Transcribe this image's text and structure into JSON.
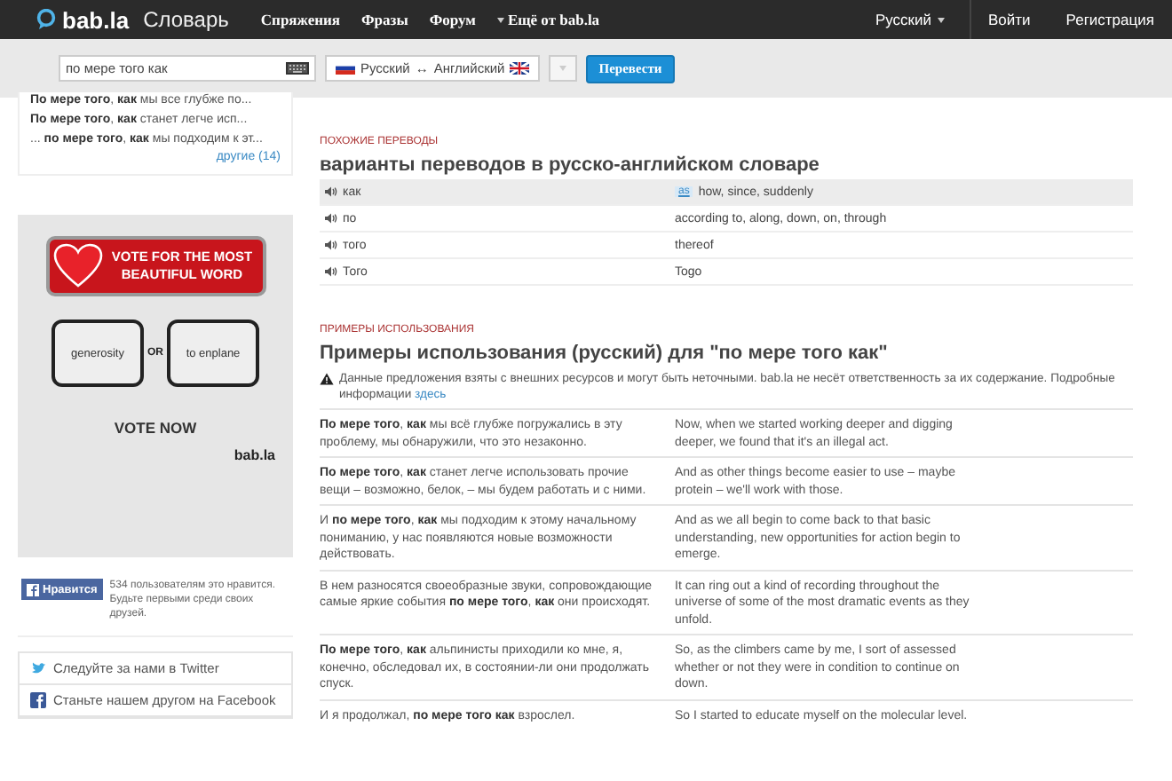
{
  "header": {
    "logo": "bab.la",
    "title": "Словарь",
    "nav": [
      {
        "label": "Спряжения",
        "kind": "link"
      },
      {
        "label": "Фразы",
        "kind": "link"
      },
      {
        "label": "Форум",
        "kind": "link"
      },
      {
        "label": "Ещё от bab.la",
        "kind": "menu"
      }
    ],
    "language": "Русский",
    "login": "Войти",
    "register": "Регистрация"
  },
  "search": {
    "value": "по мере того как",
    "from": "Русский",
    "arrow": "↔",
    "to": "Английский",
    "button": "Перевести"
  },
  "sidebar": {
    "snippets": [
      "**По мере того**, **как** мы все глубже по...",
      "**По мере того**, **как** станет легче исп...",
      "... **по мере того**, **как** мы подходим к эт..."
    ],
    "more": "другие (14)",
    "ad": {
      "banner": "VOTE FOR THE MOST BEAUTIFUL WORD",
      "left": "generosity",
      "or": "OR",
      "right": "to enplane",
      "cta": "VOTE NOW",
      "logo": "bab.la"
    },
    "like": {
      "button": "Нравится",
      "text": "534 пользователям это нравится. Будьте первыми среди своих друзей."
    },
    "social": [
      {
        "kind": "twitter",
        "label": "Следуйте за нами в Twitter"
      },
      {
        "kind": "facebook",
        "label": "Станьте нашем другом на Facebook"
      }
    ]
  },
  "similar": {
    "label": "ПОХОЖИЕ ПЕРЕВОДЫ",
    "title": "варианты переводов в русско-английском словаре",
    "rows": [
      {
        "term": "как",
        "tag": "as",
        "translation": "how, since, suddenly",
        "highlighted": true
      },
      {
        "term": "по",
        "translation": "according to, along, down, on, through",
        "highlighted": false
      },
      {
        "term": "того",
        "translation": "thereof",
        "highlighted": false
      },
      {
        "term": "Того",
        "translation": "Togo",
        "highlighted": false
      }
    ]
  },
  "examples": {
    "label": "ПРИМЕРЫ ИСПОЛЬЗОВАНИЯ",
    "title": "Примеры использования (русский) для \"по мере того как\"",
    "notice": "Данные предложения взяты с внешних ресурсов и могут быть неточными. bab.la не несёт ответственность за их содержание. Подробные информации",
    "link": "здесь",
    "rows": [
      {
        "ru": "**По мере того**, **как** мы всё глубже погружались в эту проблему, мы обнаружили, что это незаконно.",
        "en": "Now, when we started working deeper and digging deeper, we found that it's an illegal act."
      },
      {
        "ru": "**По мере того**, **как** станет легче использовать прочие вещи – возможно, белок, – мы будем работать и с ними.",
        "en": "And as other things become easier to use – maybe protein – we'll work with those."
      },
      {
        "ru": "И **по мере того**, **как** мы подходим к этому начальному пониманию, у нас появляются новые возможности действовать.",
        "en": "And as we all begin to come back to that basic understanding, new opportunities for action begin to emerge."
      },
      {
        "ru": "В нем разносятся своеобразные звуки, сопровождающие самые яркие события **по мере того**, **как** они происходят.",
        "en": "It can ring out a kind of recording throughout the universe of some of the most dramatic events as they unfold."
      },
      {
        "ru": "**По мере того**, **как** альпинисты приходили ко мне, я, конечно, обследовал их, в состоянии-ли они продолжать спуск.",
        "en": "So, as the climbers came by me, I sort of assessed whether or not they were in condition to continue on down."
      },
      {
        "ru": "И я продолжал, **по мере того как** взрослел.",
        "en": "So I started to educate myself on the molecular level."
      }
    ]
  }
}
